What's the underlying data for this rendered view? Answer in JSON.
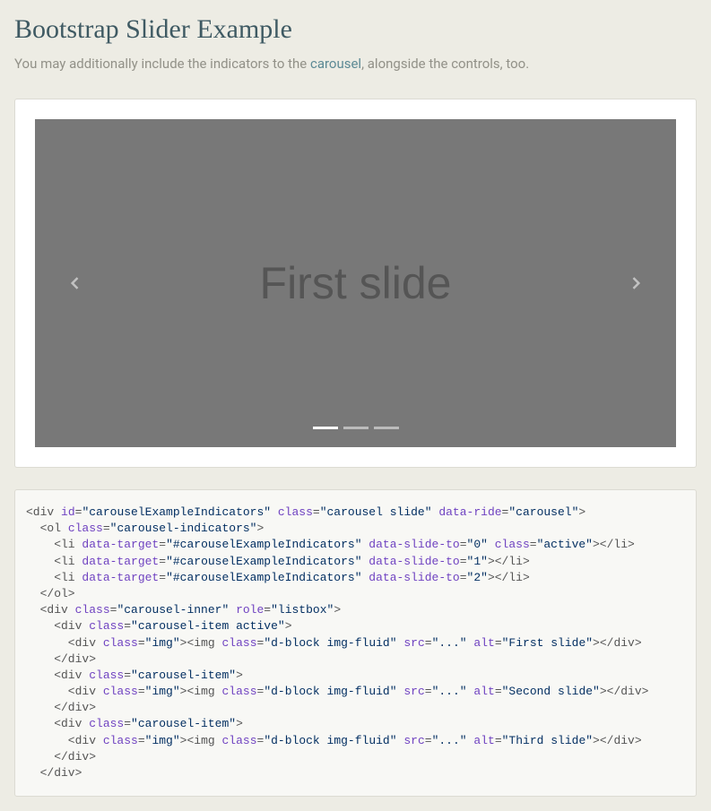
{
  "page_title": "Bootstrap Slider Example",
  "intro": {
    "before": "You may additionally include the indicators to the ",
    "link": "carousel",
    "after": ", alongside the controls, too."
  },
  "carousel": {
    "slide_label": "First slide",
    "indicators": [
      "active",
      "",
      ""
    ]
  },
  "code": {
    "line1_open": "<div ",
    "line1_id_attr": "id",
    "line1_id_val": "\"carouselExampleIndicators\"",
    "line1_class_attr": " class",
    "line1_class_val": "\"carousel slide\"",
    "line1_ride_attr": " data-ride",
    "line1_ride_val": "\"carousel\"",
    "line1_close": ">",
    "line2_open": "  <ol ",
    "line2_class_attr": "class",
    "line2_class_val": "\"carousel-indicators\"",
    "line2_close": ">",
    "line3_open": "    <li ",
    "line3_dt_attr": "data-target",
    "line3_dt_val": "\"#carouselExampleIndicators\"",
    "line3_ds_attr": " data-slide-to",
    "line3_ds_val": "\"0\"",
    "line3_cl_attr": " class",
    "line3_cl_val": "\"active\"",
    "line3_close": "></li>",
    "line4_open": "    <li ",
    "line4_dt_attr": "data-target",
    "line4_dt_val": "\"#carouselExampleIndicators\"",
    "line4_ds_attr": " data-slide-to",
    "line4_ds_val": "\"1\"",
    "line4_close": "></li>",
    "line5_open": "    <li ",
    "line5_dt_attr": "data-target",
    "line5_dt_val": "\"#carouselExampleIndicators\"",
    "line5_ds_attr": " data-slide-to",
    "line5_ds_val": "\"2\"",
    "line5_close": "></li>",
    "line6": "  </ol>",
    "line7_open": "  <div ",
    "line7_cl_attr": "class",
    "line7_cl_val": "\"carousel-inner\"",
    "line7_rl_attr": " role",
    "line7_rl_val": "\"listbox\"",
    "line7_close": ">",
    "line8_open": "    <div ",
    "line8_cl_attr": "class",
    "line8_cl_val": "\"carousel-item active\"",
    "line8_close": ">",
    "line9_open": "      <div ",
    "line9_cl_attr": "class",
    "line9_cl_val": "\"img\"",
    "line9_mid": "><img ",
    "line9_cl2_attr": "class",
    "line9_cl2_val": "\"d-block img-fluid\"",
    "line9_src_attr": " src",
    "line9_src_val": "\"...\"",
    "line9_alt_attr": " alt",
    "line9_alt_val": "\"First slide\"",
    "line9_close": "></div>",
    "line10": "    </div>",
    "line11_open": "    <div ",
    "line11_cl_attr": "class",
    "line11_cl_val": "\"carousel-item\"",
    "line11_close": ">",
    "line12_open": "      <div ",
    "line12_cl_attr": "class",
    "line12_cl_val": "\"img\"",
    "line12_mid": "><img ",
    "line12_cl2_attr": "class",
    "line12_cl2_val": "\"d-block img-fluid\"",
    "line12_src_attr": " src",
    "line12_src_val": "\"...\"",
    "line12_alt_attr": " alt",
    "line12_alt_val": "\"Second slide\"",
    "line12_close": "></div>",
    "line13": "    </div>",
    "line14_open": "    <div ",
    "line14_cl_attr": "class",
    "line14_cl_val": "\"carousel-item\"",
    "line14_close": ">",
    "line15_open": "      <div ",
    "line15_cl_attr": "class",
    "line15_cl_val": "\"img\"",
    "line15_mid": "><img ",
    "line15_cl2_attr": "class",
    "line15_cl2_val": "\"d-block img-fluid\"",
    "line15_src_attr": " src",
    "line15_src_val": "\"...\"",
    "line15_alt_attr": " alt",
    "line15_alt_val": "\"Third slide\"",
    "line15_close": "></div>",
    "line16": "    </div>",
    "line17": "  </div>"
  }
}
